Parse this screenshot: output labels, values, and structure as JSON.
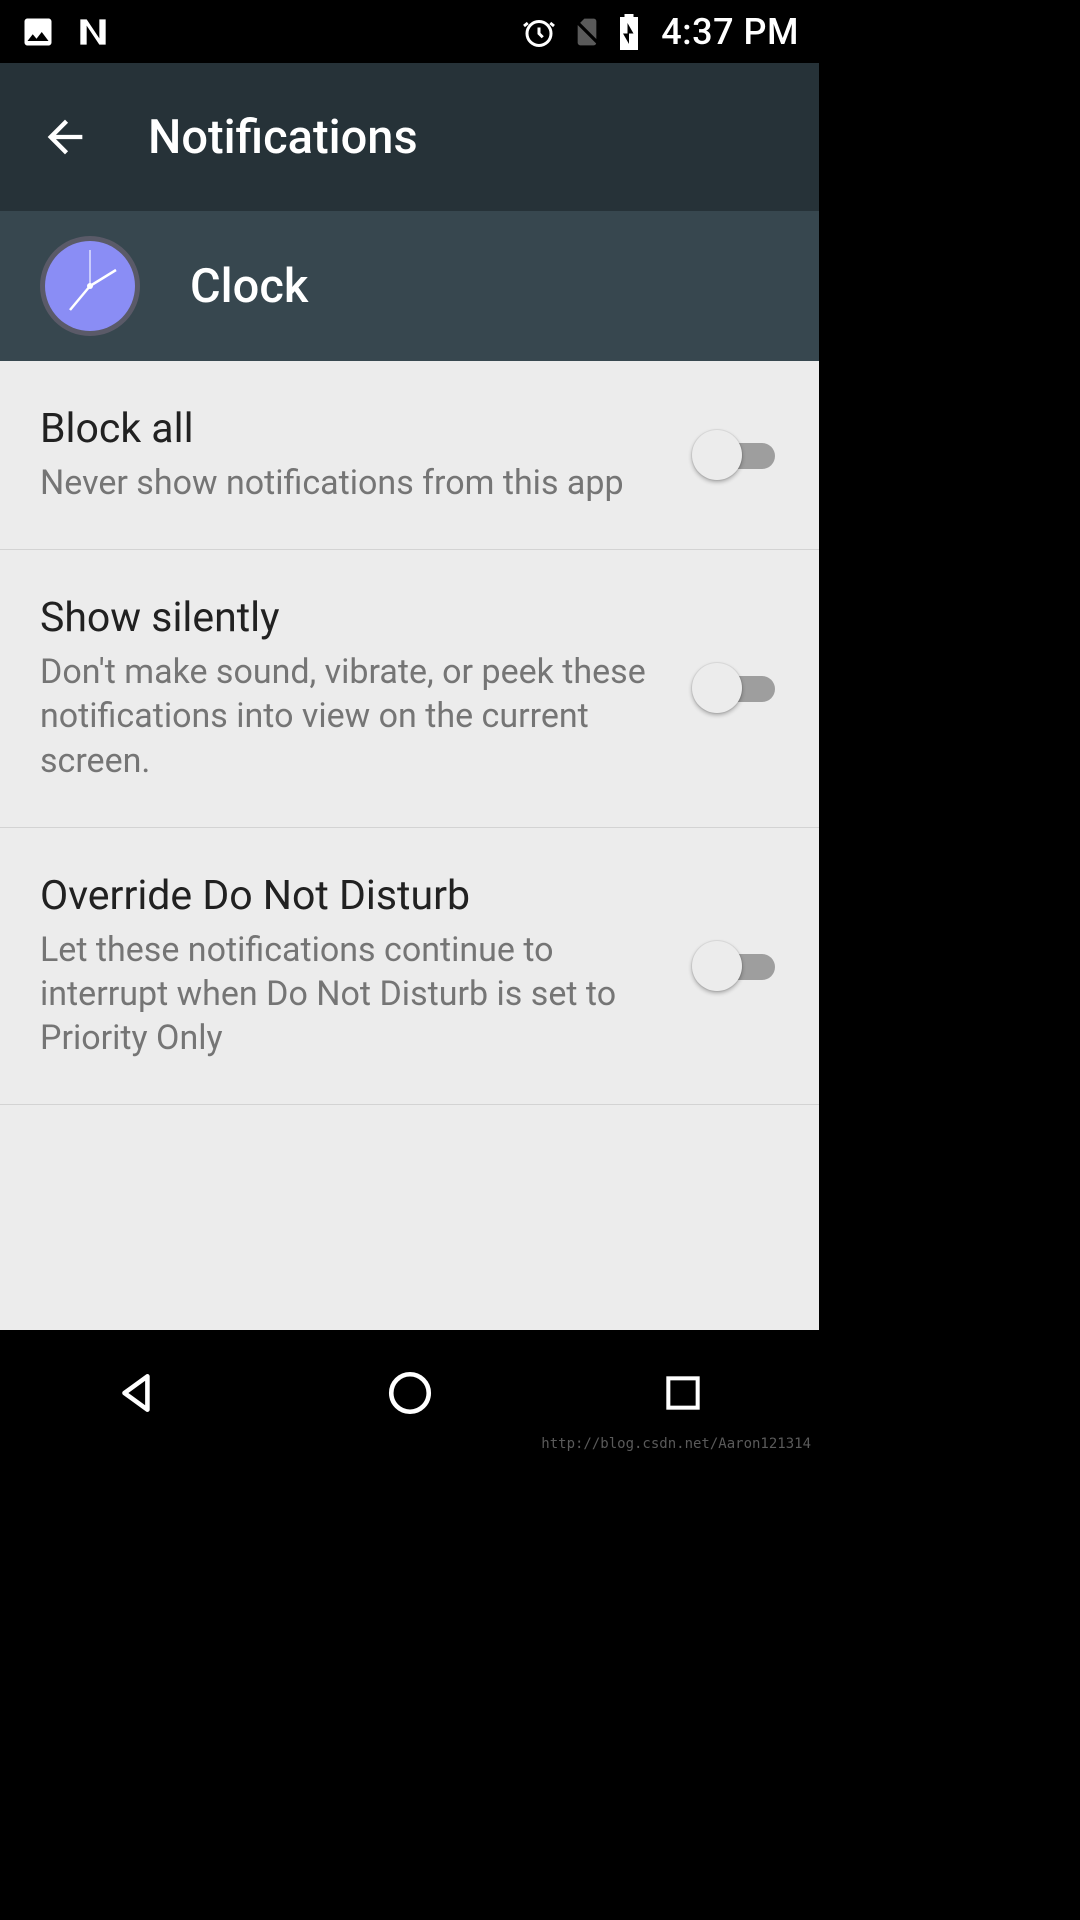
{
  "status_bar": {
    "time": "4:37 PM"
  },
  "app_bar": {
    "title": "Notifications"
  },
  "sub_header": {
    "app_name": "Clock"
  },
  "settings": [
    {
      "title": "Block all",
      "desc": "Never show notifications from this app",
      "on": false
    },
    {
      "title": "Show silently",
      "desc": "Don't make sound, vibrate, or peek these notifications into view on the current screen.",
      "on": false
    },
    {
      "title": "Override Do Not Disturb",
      "desc": "Let these notifications continue to interrupt when Do Not Disturb is set to Priority Only",
      "on": false
    }
  ],
  "watermark": "http://blog.csdn.net/Aaron121314"
}
